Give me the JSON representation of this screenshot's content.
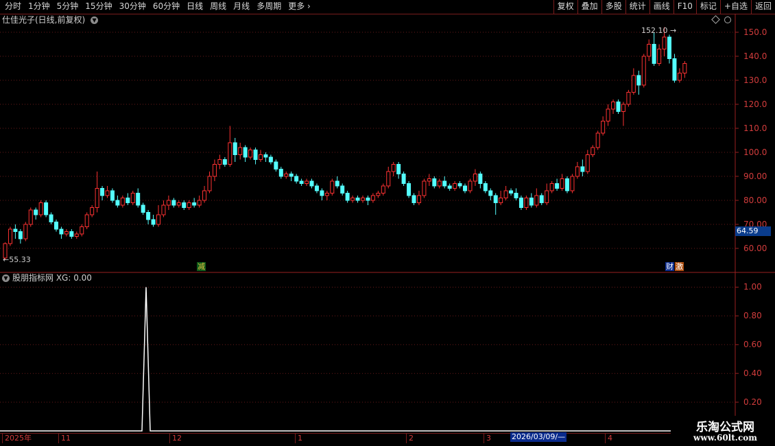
{
  "toolbar": {
    "periods": [
      {
        "label": "分时"
      },
      {
        "label": "1分钟"
      },
      {
        "label": "5分钟"
      },
      {
        "label": "15分钟"
      },
      {
        "label": "30分钟"
      },
      {
        "label": "60分钟"
      },
      {
        "label": "日线"
      },
      {
        "label": "周线"
      },
      {
        "label": "月线"
      },
      {
        "label": "多周期"
      },
      {
        "label": "更多"
      }
    ],
    "more_icon": "chevron-right-icon",
    "right_buttons": [
      {
        "label": "复权"
      },
      {
        "label": "叠加"
      },
      {
        "label": "多股"
      },
      {
        "label": "统计"
      },
      {
        "label": "画线"
      },
      {
        "label": "F10"
      },
      {
        "label": "标记"
      },
      {
        "label": "+自选"
      },
      {
        "label": "返回"
      }
    ]
  },
  "main_chart": {
    "title": "仕佳光子(日线,前复权)",
    "price_axis": [
      "150.0",
      "140.0",
      "130.0",
      "120.0",
      "110.0",
      "100.0",
      "90.00",
      "80.00",
      "70.00",
      "60.00"
    ],
    "current_price_tag": "64.59",
    "high_marker": "152.10",
    "low_marker": "55.33",
    "badge_jian": "减",
    "badge_cai": "财",
    "badge_ji": "激",
    "colors": {
      "up": "#ff3232",
      "down": "#54ffff"
    }
  },
  "indicator": {
    "title": "股朋指标网 XG: 0.00",
    "axis": [
      "1.00",
      "0.80",
      "0.60",
      "0.40",
      "0.20"
    ],
    "line_color": "#ffffff"
  },
  "date_axis": {
    "labels": [
      "2025年",
      "11",
      "12",
      "1",
      "2",
      "3",
      "4"
    ],
    "cursor_date": "2026/03/09/—"
  },
  "watermark": {
    "line1": "乐淘公式网",
    "line2": "www.60lt.com"
  },
  "chart_data": {
    "type": "candlestick",
    "y_range": [
      55,
      152
    ],
    "candles": [
      [
        56,
        62,
        55.3,
        62.5
      ],
      [
        62,
        68,
        61,
        69
      ],
      [
        68,
        67,
        64,
        70
      ],
      [
        67,
        64,
        62,
        68
      ],
      [
        64,
        70,
        63,
        71
      ],
      [
        70,
        76,
        69,
        77
      ],
      [
        76,
        74,
        72,
        77
      ],
      [
        74,
        79,
        73,
        80
      ],
      [
        79,
        74,
        73,
        80
      ],
      [
        74,
        71,
        70,
        75
      ],
      [
        71,
        68,
        67,
        72
      ],
      [
        68,
        66,
        64,
        69
      ],
      [
        66,
        67,
        65,
        68
      ],
      [
        67,
        65,
        64,
        68
      ],
      [
        65,
        66,
        64,
        67
      ],
      [
        66,
        69,
        65,
        70
      ],
      [
        69,
        74,
        68,
        75
      ],
      [
        74,
        77,
        73,
        78
      ],
      [
        77,
        85,
        75,
        92
      ],
      [
        85,
        82,
        80,
        86
      ],
      [
        82,
        84,
        81,
        86
      ],
      [
        84,
        80,
        79,
        85
      ],
      [
        80,
        78,
        77,
        82
      ],
      [
        78,
        81,
        77,
        82
      ],
      [
        81,
        79,
        78,
        83
      ],
      [
        79,
        83,
        78,
        84
      ],
      [
        83,
        78,
        77,
        85
      ],
      [
        78,
        75,
        74,
        79
      ],
      [
        75,
        72,
        70,
        76
      ],
      [
        72,
        70,
        69,
        74
      ],
      [
        70,
        74,
        69,
        78
      ],
      [
        74,
        78,
        73,
        80
      ],
      [
        78,
        80,
        76,
        82
      ],
      [
        80,
        78,
        77,
        81
      ],
      [
        78,
        79,
        77,
        80
      ],
      [
        79,
        77,
        76,
        80
      ],
      [
        77,
        79,
        76,
        80
      ],
      [
        79,
        78,
        77,
        81
      ],
      [
        78,
        80,
        77,
        82
      ],
      [
        80,
        84,
        79,
        86
      ],
      [
        84,
        90,
        83,
        92
      ],
      [
        90,
        95,
        88,
        97
      ],
      [
        95,
        97,
        93,
        99
      ],
      [
        97,
        95,
        94,
        98
      ],
      [
        95,
        104,
        94,
        111
      ],
      [
        104,
        99,
        96,
        106
      ],
      [
        99,
        102,
        97,
        104
      ],
      [
        102,
        98,
        96,
        103
      ],
      [
        98,
        101,
        97,
        102
      ],
      [
        101,
        97,
        95,
        102
      ],
      [
        97,
        99,
        96,
        101
      ],
      [
        99,
        98,
        96,
        100
      ],
      [
        98,
        96,
        95,
        99
      ],
      [
        96,
        93,
        92,
        97
      ],
      [
        93,
        90,
        89,
        94
      ],
      [
        90,
        91,
        89,
        92
      ],
      [
        91,
        90,
        88,
        92
      ],
      [
        90,
        88,
        87,
        91
      ],
      [
        88,
        87,
        86,
        89
      ],
      [
        87,
        88,
        86,
        89
      ],
      [
        88,
        86,
        85,
        89
      ],
      [
        86,
        84,
        83,
        87
      ],
      [
        84,
        82,
        80,
        85
      ],
      [
        82,
        83,
        80,
        84
      ],
      [
        83,
        88,
        82,
        89
      ],
      [
        88,
        86,
        85,
        90
      ],
      [
        86,
        83,
        82,
        87
      ],
      [
        83,
        80,
        79,
        84
      ],
      [
        80,
        81,
        79,
        82
      ],
      [
        81,
        80,
        79,
        82
      ],
      [
        80,
        81,
        79,
        82
      ],
      [
        81,
        80,
        78,
        82
      ],
      [
        80,
        82,
        79,
        83
      ],
      [
        82,
        83,
        81,
        84
      ],
      [
        83,
        86,
        82,
        87
      ],
      [
        86,
        92,
        85,
        94
      ],
      [
        92,
        95,
        90,
        96
      ],
      [
        95,
        91,
        89,
        96
      ],
      [
        91,
        87,
        86,
        92
      ],
      [
        87,
        82,
        81,
        88
      ],
      [
        82,
        79,
        78,
        83
      ],
      [
        79,
        82,
        78,
        84
      ],
      [
        82,
        88,
        81,
        89
      ],
      [
        88,
        89,
        86,
        91
      ],
      [
        89,
        86,
        85,
        90
      ],
      [
        86,
        88,
        85,
        89
      ],
      [
        88,
        86,
        85,
        90
      ],
      [
        86,
        85,
        84,
        87
      ],
      [
        85,
        87,
        84,
        88
      ],
      [
        87,
        86,
        85,
        88
      ],
      [
        86,
        84,
        83,
        87
      ],
      [
        84,
        88,
        83,
        89
      ],
      [
        88,
        91,
        86,
        93
      ],
      [
        91,
        87,
        85,
        92
      ],
      [
        87,
        84,
        83,
        88
      ],
      [
        84,
        82,
        80,
        85
      ],
      [
        82,
        79,
        74,
        83
      ],
      [
        79,
        81,
        78,
        84
      ],
      [
        81,
        84,
        80,
        86
      ],
      [
        84,
        83,
        82,
        85
      ],
      [
        83,
        81,
        80,
        85
      ],
      [
        81,
        77,
        76,
        82
      ],
      [
        77,
        81,
        76,
        82
      ],
      [
        81,
        78,
        77,
        83
      ],
      [
        78,
        82,
        77,
        85
      ],
      [
        82,
        79,
        78,
        83
      ],
      [
        79,
        84,
        78,
        87
      ],
      [
        84,
        87,
        83,
        88
      ],
      [
        87,
        85,
        84,
        89
      ],
      [
        85,
        89,
        84,
        91
      ],
      [
        89,
        84,
        83,
        90
      ],
      [
        84,
        90,
        83,
        91
      ],
      [
        90,
        94,
        89,
        96
      ],
      [
        94,
        92,
        90,
        97
      ],
      [
        92,
        99,
        91,
        101
      ],
      [
        99,
        102,
        98,
        103
      ],
      [
        102,
        108,
        101,
        109
      ],
      [
        108,
        113,
        107,
        115
      ],
      [
        113,
        118,
        111,
        120
      ],
      [
        118,
        121,
        116,
        122
      ],
      [
        121,
        117,
        116,
        122
      ],
      [
        117,
        120,
        111,
        121
      ],
      [
        120,
        125,
        119,
        126
      ],
      [
        125,
        132,
        124,
        135
      ],
      [
        132,
        128,
        124,
        134
      ],
      [
        128,
        140,
        127,
        141
      ],
      [
        140,
        145,
        138,
        147
      ],
      [
        145,
        137,
        136,
        150
      ],
      [
        137,
        143,
        136,
        145
      ],
      [
        143,
        148,
        140,
        152.1
      ],
      [
        148,
        139,
        137,
        149
      ],
      [
        139,
        130,
        129,
        141
      ],
      [
        130,
        133,
        129,
        135
      ],
      [
        133,
        137,
        131,
        138
      ]
    ],
    "indicator_xg": {
      "peak_value": 1.0,
      "baseline": 0.0
    },
    "indicator_range": [
      0,
      1.05
    ]
  }
}
